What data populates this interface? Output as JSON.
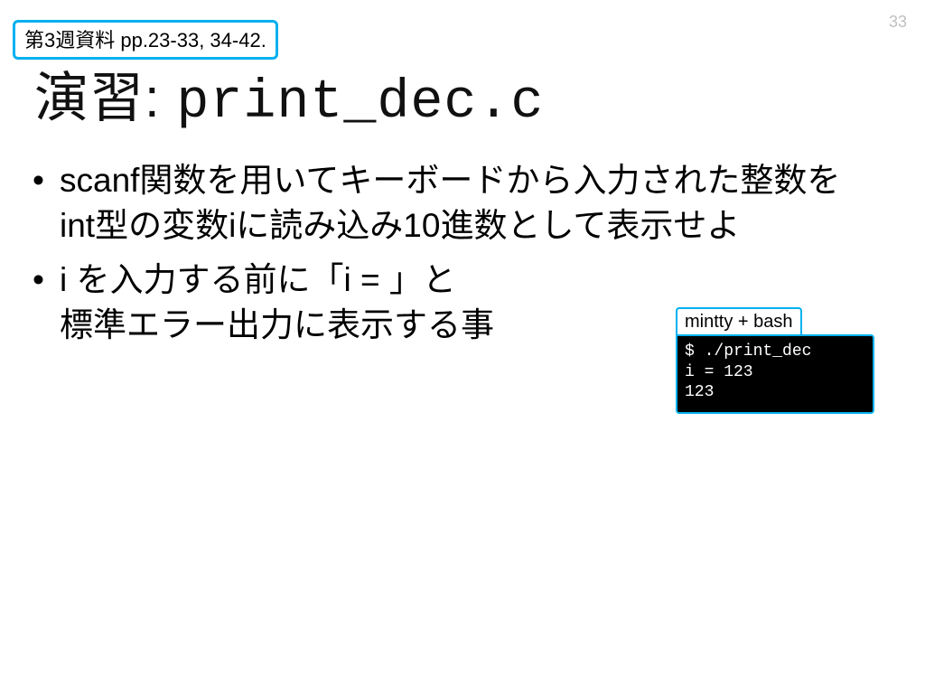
{
  "page_number": "33",
  "reference_box": "第3週資料 pp.23-33, 34-42.",
  "title_prefix": "演習: ",
  "title_filename": "print_dec.c",
  "bullets": [
    "scanf関数を用いてキーボードから入力された整数をint型の変数iに読み込み10進数として表示せよ",
    "i を入力する前に「i = 」と\n標準エラー出力に表示する事"
  ],
  "terminal": {
    "label": "mintty + bash",
    "lines": "$ ./print_dec\ni = 123\n123"
  }
}
